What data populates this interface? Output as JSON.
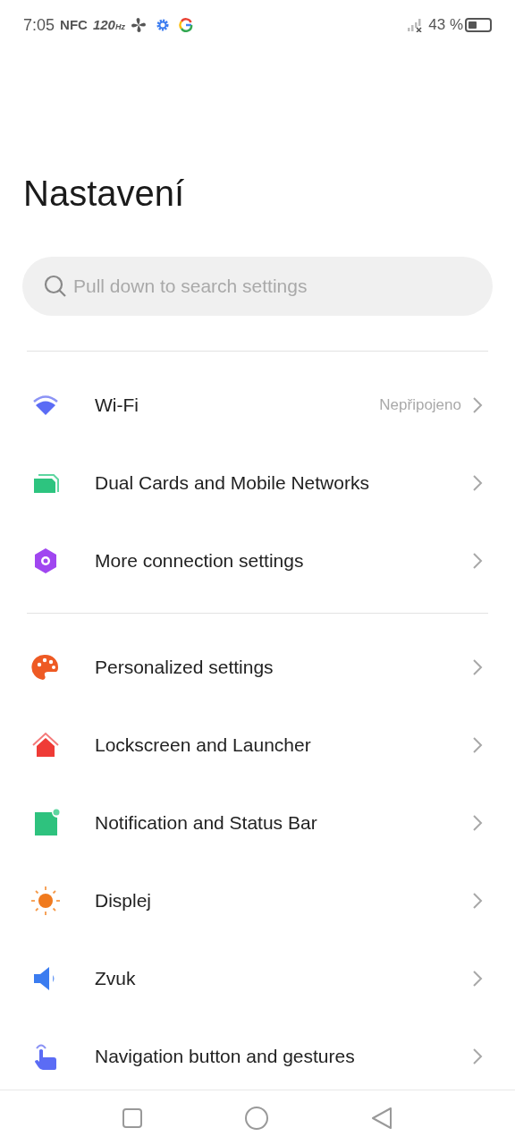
{
  "status_bar": {
    "time": "7:05",
    "nfc": "NFC",
    "refresh_rate": "120",
    "refresh_unit": "Hz",
    "battery_percent": "43 %"
  },
  "title": "Nastavení",
  "search": {
    "placeholder": "Pull down to search settings"
  },
  "sections": [
    [
      {
        "label": "Wi-Fi",
        "value": "Nepřipojeno"
      },
      {
        "label": "Dual Cards and Mobile Networks"
      },
      {
        "label": "More connection settings"
      }
    ],
    [
      {
        "label": "Personalized settings"
      },
      {
        "label": "Lockscreen and Launcher"
      },
      {
        "label": "Notification and Status Bar"
      },
      {
        "label": "Displej"
      },
      {
        "label": "Zvuk"
      },
      {
        "label": "Navigation button and gestures"
      }
    ]
  ]
}
